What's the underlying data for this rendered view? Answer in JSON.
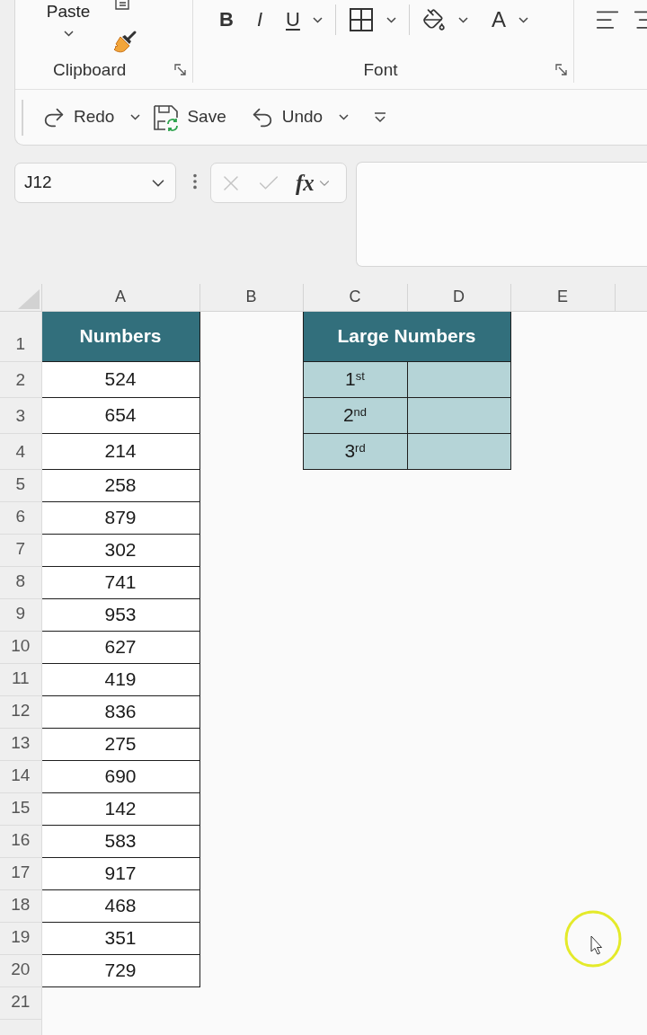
{
  "ribbon": {
    "groups": [
      {
        "kind": "clipboard",
        "label": "Clipboard",
        "paste_label": "Paste"
      },
      {
        "kind": "font",
        "label": "Font",
        "buttons": [
          {
            "kind": "bold",
            "label": "B",
            "dropdown": false
          },
          {
            "kind": "italic",
            "label": "I",
            "dropdown": false
          },
          {
            "kind": "underline",
            "label": "U",
            "dropdown": true
          },
          {
            "kind": "borders",
            "dropdown": true
          },
          {
            "kind": "fill_color",
            "dropdown": true
          },
          {
            "kind": "font_color",
            "label": "A",
            "dropdown": true
          }
        ]
      },
      {
        "kind": "alignment"
      }
    ]
  },
  "quick_access_toolbar": [
    {
      "kind": "redo",
      "label": "Redo",
      "dropdown": true
    },
    {
      "kind": "save",
      "label": "Save",
      "dropdown": false
    },
    {
      "kind": "undo",
      "label": "Undo",
      "dropdown": true
    }
  ],
  "formula_bar": {
    "name_box": "J12",
    "function_label": "fx"
  },
  "sheet": {
    "columns": [
      "A",
      "B",
      "C",
      "D",
      "E"
    ],
    "row_numbers": [
      "1",
      "2",
      "3",
      "4",
      "5",
      "6",
      "7",
      "8",
      "9",
      "10",
      "11",
      "12",
      "13",
      "14",
      "15",
      "16",
      "17",
      "18",
      "19",
      "20",
      "21"
    ],
    "numbers_table": {
      "header": "Numbers",
      "values": [
        "524",
        "654",
        "214",
        "258",
        "879",
        "302",
        "741",
        "953",
        "627",
        "419",
        "836",
        "275",
        "690",
        "142",
        "583",
        "917",
        "468",
        "351",
        "729"
      ]
    },
    "large_numbers_table": {
      "header": "Large Numbers",
      "ranks": [
        "1$^{st}$",
        "2$^{nd}$",
        "3$^{rd}$"
      ]
    }
  }
}
